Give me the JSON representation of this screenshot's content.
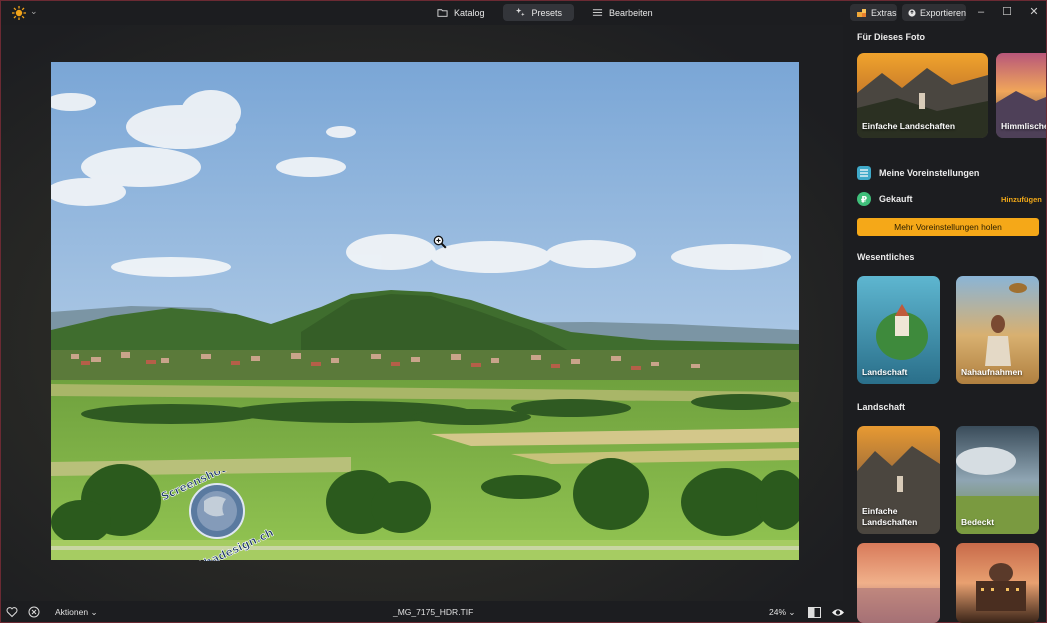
{
  "topbar": {
    "tabs": [
      {
        "label": "Katalog",
        "icon": "folder-icon",
        "active": false
      },
      {
        "label": "Presets",
        "icon": "sparkle-icon",
        "active": true
      },
      {
        "label": "Bearbeiten",
        "icon": "sliders-icon",
        "active": false
      }
    ],
    "extras_label": "Extras",
    "export_label": "Exportieren",
    "window_controls": {
      "minimize": "–",
      "maximize": "☐",
      "close": "✕"
    }
  },
  "canvas": {
    "watermark_lines": [
      "Screenshot by",
      "Ahadesign.ch"
    ]
  },
  "bottombar": {
    "actions_label": "Aktionen ⌄",
    "filename": "_MG_7175_HDR.TIF",
    "zoom_label": "24% ⌄"
  },
  "panel": {
    "section_for_photo": "Für Dieses Foto",
    "photo_cards": [
      {
        "label": "Einfache Landschaften"
      },
      {
        "label": "Himmlische"
      }
    ],
    "my_presets_label": "Meine Voreinstellungen",
    "purchased_label": "Gekauft",
    "add_label": "Hinzufügen",
    "more_presets_button": "Mehr Voreinstellungen holen",
    "section_essentials": "Wesentliches",
    "essential_cards": [
      {
        "label": "Landschaft"
      },
      {
        "label": "Nahaufnahmen"
      }
    ],
    "section_landscape": "Landschaft",
    "landscape_cards": [
      {
        "label": "Einfache Landschaften"
      },
      {
        "label": "Bedeckt"
      },
      {
        "label": ""
      },
      {
        "label": ""
      }
    ]
  },
  "colors": {
    "accent": "#f5a818",
    "background": "#1c1d20",
    "panel_button": "#2f3034"
  }
}
